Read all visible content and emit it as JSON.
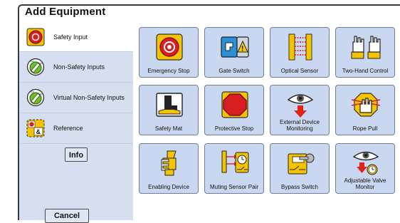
{
  "dialog": {
    "title": "Add Equipment"
  },
  "sidebar": {
    "items": [
      {
        "label": "Safety Input",
        "icon": "emergency-stop-icon"
      },
      {
        "label": "Non-Safety Inputs",
        "icon": "selector-switch-icon"
      },
      {
        "label": "Virtual Non-Safety Inputs",
        "icon": "virtual-selector-switch-icon"
      },
      {
        "label": "Reference",
        "icon": "reference-icon"
      }
    ],
    "info_label": "Info",
    "cancel_label": "Cancel"
  },
  "tiles": [
    {
      "label": "Emergency Stop",
      "icon": "emergency-stop-icon"
    },
    {
      "label": "Gate Switch",
      "icon": "gate-switch-icon"
    },
    {
      "label": "Optical Sensor",
      "icon": "optical-sensor-icon"
    },
    {
      "label": "Two-Hand Control",
      "icon": "two-hand-control-icon"
    },
    {
      "label": "Safety Mat",
      "icon": "safety-mat-icon"
    },
    {
      "label": "Protective Stop",
      "icon": "protective-stop-icon"
    },
    {
      "label": "External Device Monitoring",
      "icon": "external-device-monitoring-icon"
    },
    {
      "label": "Rope Pull",
      "icon": "rope-pull-icon"
    },
    {
      "label": "Enabling Device",
      "icon": "enabling-device-icon"
    },
    {
      "label": "Muting Sensor Pair",
      "icon": "muting-sensor-pair-icon"
    },
    {
      "label": "Bypass Switch",
      "icon": "bypass-switch-icon"
    },
    {
      "label": "Adjustable Valve Monitor",
      "icon": "adjustable-valve-monitor-icon"
    }
  ]
}
